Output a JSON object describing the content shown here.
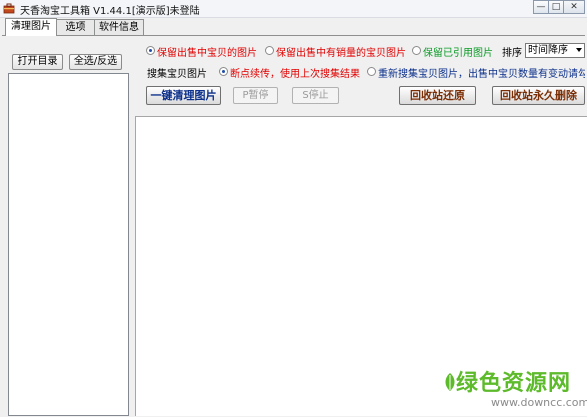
{
  "window": {
    "title": "天香淘宝工具箱 V1.44.1[演示版]未登陆",
    "minimize_glyph": "—",
    "restore_glyph": "□",
    "close_glyph": "✕"
  },
  "tabs": [
    {
      "label": "清理图片",
      "active": true
    },
    {
      "label": "选项",
      "active": false
    },
    {
      "label": "软件信息",
      "active": false
    }
  ],
  "left_panel": {
    "open_dir_label": "打开目录",
    "select_all_label": "全选/反选"
  },
  "keep_options": [
    {
      "label": "保留出售中宝贝的图片",
      "checked": true,
      "color": "#e00000"
    },
    {
      "label": "保留出售中有销量的宝贝图片",
      "checked": false,
      "color": "#e00000"
    },
    {
      "label": "保留已引用图片",
      "checked": false,
      "color": "#0a9b26"
    }
  ],
  "sort": {
    "label": "排序",
    "selected": "时间降序"
  },
  "collect": {
    "label": "搜集宝贝图片",
    "options": [
      {
        "label": "断点续传，使用上次搜集结果",
        "checked": true,
        "color": "#e00000"
      },
      {
        "label": "重新搜集宝贝图片，出售中宝贝数量有变动请勾选",
        "checked": false,
        "color": "#0b2f8a"
      }
    ]
  },
  "actions": {
    "clean_label": "一键清理图片",
    "pause_label": "P暂停",
    "stop_label": "S停止",
    "restore_label": "回收站还原",
    "delete_label": "回收站永久删除"
  },
  "watermark": {
    "main": "绿色资源网",
    "sub": "www.downcc.com",
    "color": "#5dbb2b"
  }
}
